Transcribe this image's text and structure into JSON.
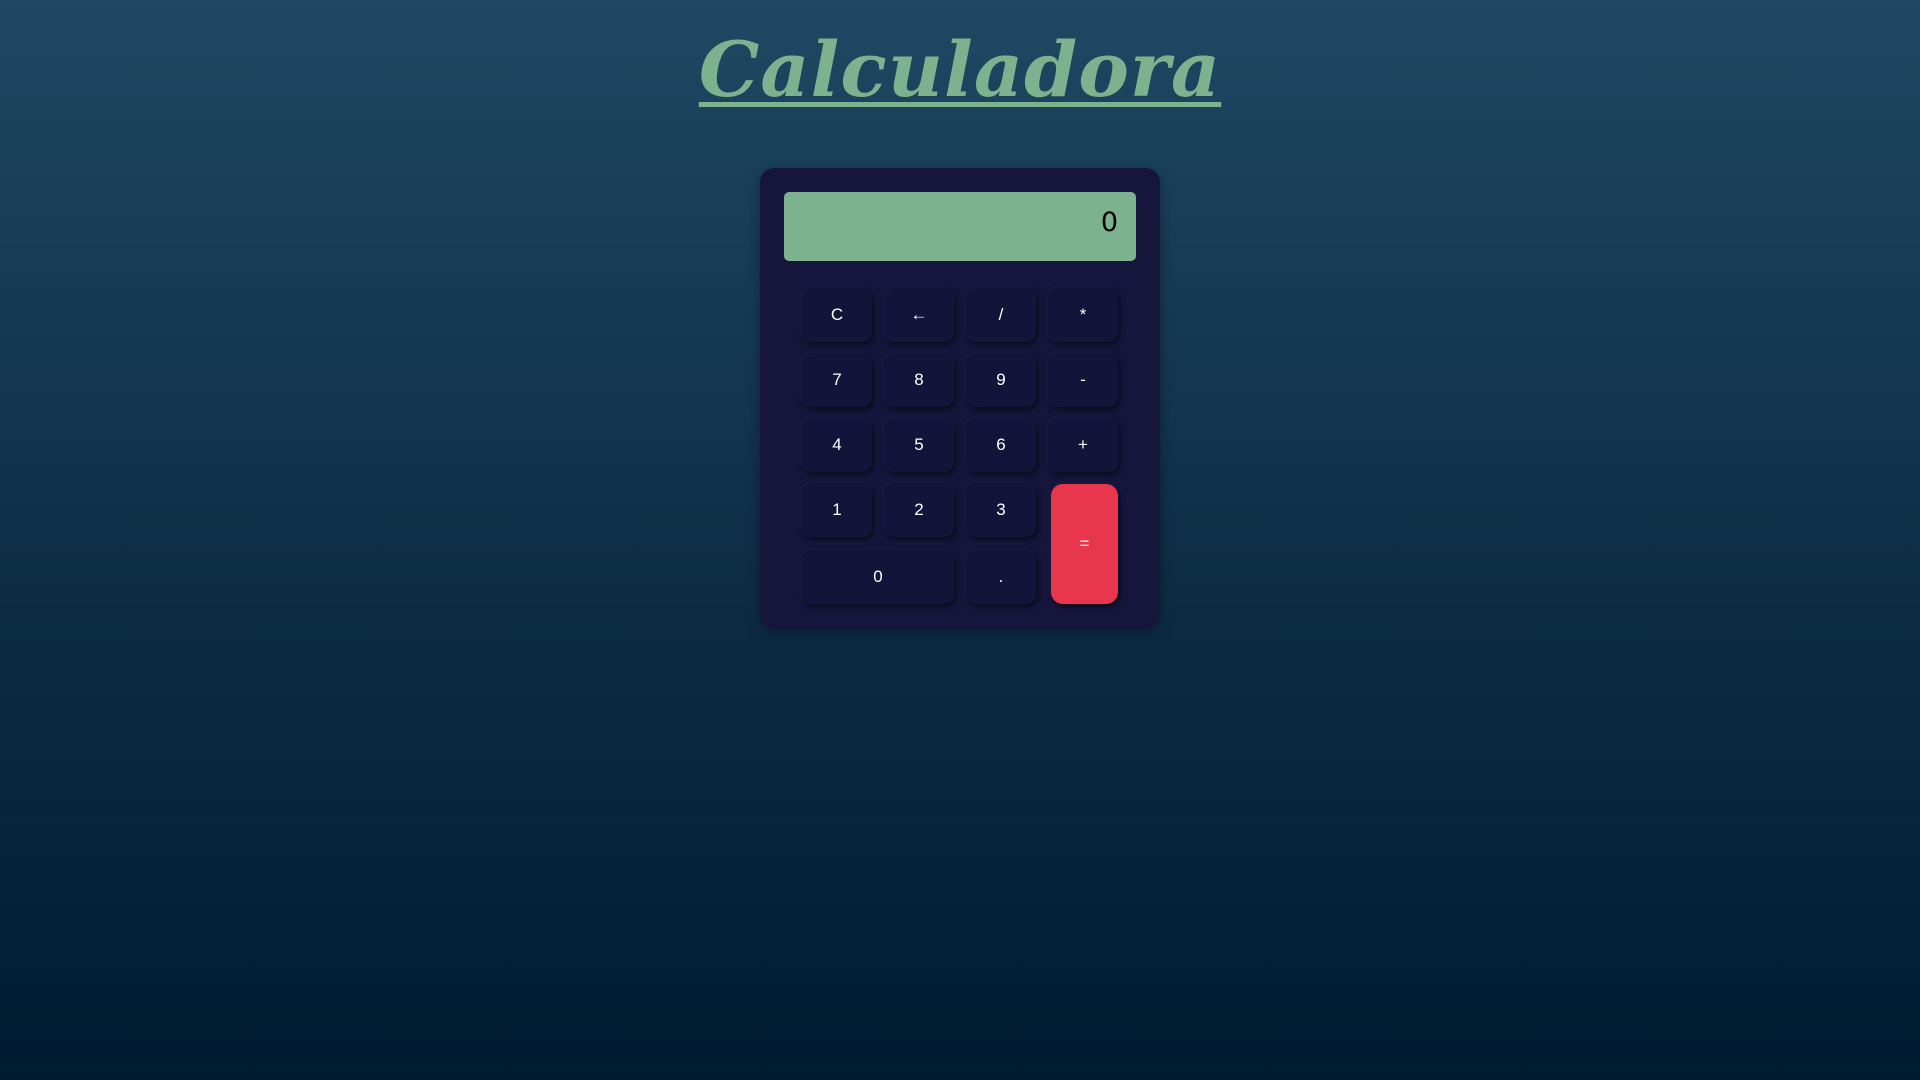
{
  "page": {
    "title": "Calculadora"
  },
  "display": {
    "value": "0"
  },
  "keys": {
    "clear": "C",
    "backspace": "←",
    "divide": "/",
    "multiply": "*",
    "seven": "7",
    "eight": "8",
    "nine": "9",
    "subtract": "-",
    "four": "4",
    "five": "5",
    "six": "6",
    "add": "+",
    "one": "1",
    "two": "2",
    "three": "3",
    "equals": "=",
    "zero": "0",
    "decimal": "."
  },
  "colors": {
    "background_top": "#1f4862",
    "background_bottom": "#001b30",
    "accent_green": "#7db28f",
    "calculator_body": "#16163d",
    "key": "#14143a",
    "equals_key": "#e8374d"
  }
}
